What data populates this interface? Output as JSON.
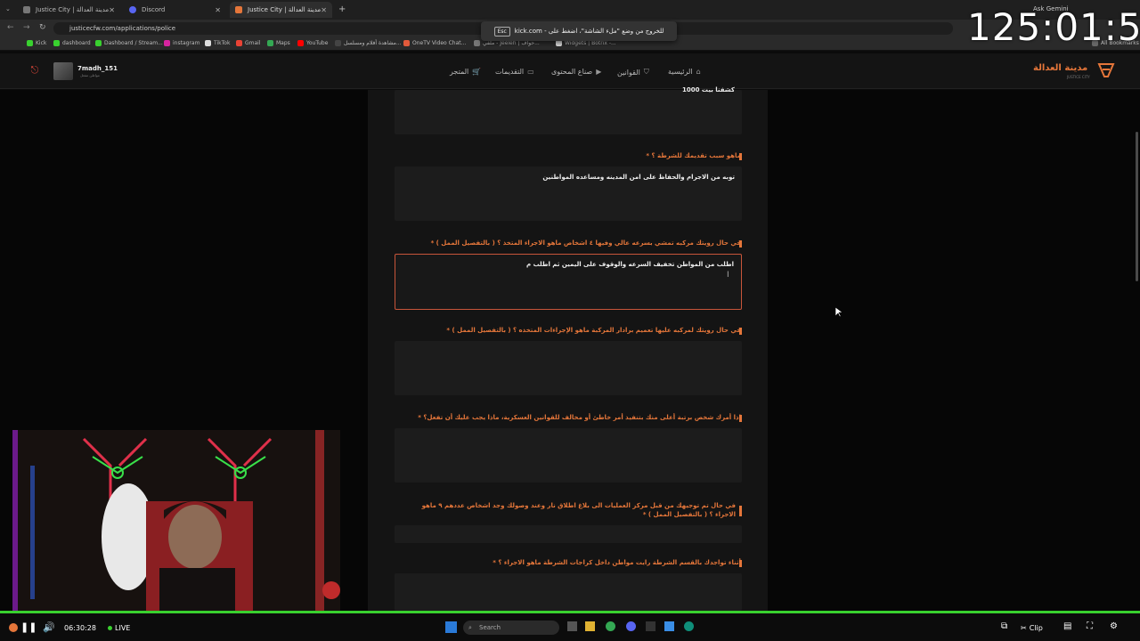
{
  "browser": {
    "tabs": [
      {
        "label": "Justice City | مدينة العدالة",
        "active": false
      },
      {
        "label": "Discord",
        "active": false
      },
      {
        "label": "Justice City | مدينة العدالة",
        "active": true
      }
    ],
    "new_tab": "+",
    "url": "justicecfw.com/applications/police",
    "bookmarks": [
      "Kick",
      "dashboard",
      "Dashboard / Stream...",
      "instagram",
      "TikTok",
      "Gmail",
      "Maps",
      "YouTube",
      "مشاهدة أفلام ومسلسل...",
      "OneTV Video Chat...",
      "ملفي - Jeeleh | حواف...",
      "Widgets | Botrix -...",
      "All Bookmarks"
    ],
    "fullscreen_notice": {
      "prefix": "kick.com - للخروج من وضع \"ملء الشاشة\"، اضغط على",
      "key": "Esc"
    },
    "ask_gemini": "Ask Gemini"
  },
  "overlay": {
    "timer": "125:01:59"
  },
  "site": {
    "brand": "مدينة العدالة",
    "brand_sub": "JUSTICE CITY",
    "nav": [
      "الرئيسية",
      "القوانين",
      "صناع المحتوى",
      "التقديمات",
      "المتجر"
    ],
    "user": {
      "name": "7madh_151",
      "role": "مواطن مفعل"
    }
  },
  "form": {
    "top_answer_fragment": "كشفنا بيت 1000",
    "questions": [
      {
        "label": "ماهو سبب تقديمك للشرطة ؟ *",
        "answer": "توبه من الاجرام والحفاظ على امن المدينه ومساعده المواطنين"
      },
      {
        "label": "في حال رويتك مركبه تمشي بسرعه عالي وفيها ٤ اشخاص ماهو الاجراء المتخذ ؟ ( بالتفصيل الممل ) *",
        "answer": "اطلب من المواطن تخفيف السرعه والوقوف على اليمين ثم اطلب م"
      },
      {
        "label": "في حال رويتك لمركبه عليها تعميم برادار المركبة ماهو الإجراءات المتخذه ؟ ( بالتفصيل الممل ) *",
        "answer": ""
      },
      {
        "label": "إذا أمرك شخص برتبة أعلى منك بتنفيذ أمر خاطئ أو مخالف للقوانين العسكرية، ماذا يجب عليك أن تفعل؟ *",
        "answer": ""
      },
      {
        "label": "في حال تم توجيهك من قبل مركز العمليات الى بلاغ اطلاق نار وعند وصولك وجد اشخاص عددهم ٩ ماهو الاجراء ؟ ( بالتفصيل الممل ) *",
        "answer": ""
      },
      {
        "label": "أثناء تواجدك بالقسم الشرطة رايت مواطن داخل كراجات الشرطة ماهو الاجراء ؟ *",
        "answer": ""
      }
    ]
  },
  "stream": {
    "time": "06:30:28",
    "live": "LIVE",
    "clip": "Clip",
    "search": "Search"
  },
  "colors": {
    "accent": "#e5763a",
    "progress": "#39d12f",
    "danger": "#e0483a"
  }
}
